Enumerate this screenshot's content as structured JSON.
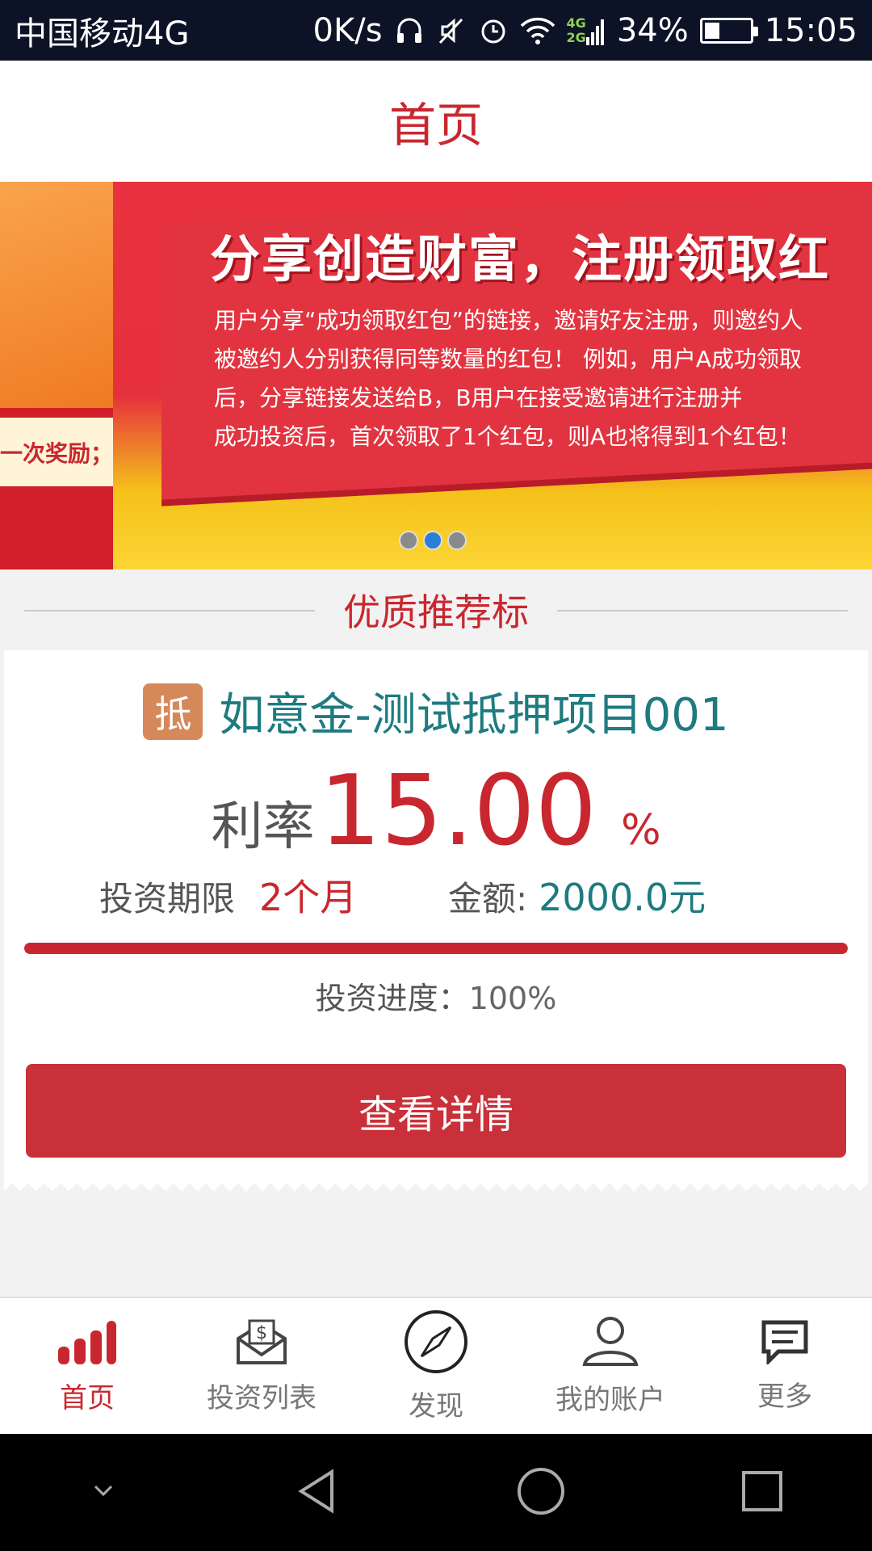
{
  "status_bar": {
    "carrier": "中国移动4G",
    "speed": "0K/s",
    "network_top": "4G",
    "network_bottom": "2G",
    "battery": "34%",
    "battery_level": 0.34,
    "time": "15:05",
    "icons": [
      "headphones-icon",
      "mute-icon",
      "alarm-icon",
      "wifi-icon",
      "signal-icon",
      "battery-icon"
    ]
  },
  "header": {
    "title": "首页"
  },
  "banner": {
    "left_text": "一次奖励；",
    "headline": "分享创造财富，注册领取红",
    "lines": [
      "用户分享“成功领取红包”的链接，邀请好友注册，则邀约人",
      "被邀约人分别获得同等数量的红包！ 例如，用户A成功领取",
      "后，分享链接发送给B，B用户在接受邀请进行注册并",
      "成功投资后，首次领取了1个红包，则A也将得到1个红包！"
    ],
    "dots_total": 3,
    "active_dot": 1
  },
  "section": {
    "title": "优质推荐标"
  },
  "product": {
    "tag": "抵",
    "name": "如意金-测试抵押项目001",
    "rate_label": "利率",
    "rate_value": "15.00",
    "rate_unit": "%",
    "term_label": "投资期限",
    "term_value": "2个月",
    "amount_label": "金额:",
    "amount_value": "2000.0元",
    "progress_label": "投资进度：",
    "progress_value": "100%",
    "progress_fraction": 1.0,
    "button_label": "查看详情"
  },
  "bottom_nav": {
    "items": [
      {
        "label": "首页",
        "icon": "bar-chart-icon",
        "active": true
      },
      {
        "label": "投资列表",
        "icon": "envelope-dollar-icon",
        "active": false
      },
      {
        "label": "发现",
        "icon": "compass-icon",
        "active": false
      },
      {
        "label": "我的账户",
        "icon": "user-icon",
        "active": false
      },
      {
        "label": "更多",
        "icon": "chat-icon",
        "active": false
      }
    ]
  },
  "colors": {
    "accent": "#c9272f",
    "teal": "#1e7b80",
    "status_bar": "#0c1327"
  }
}
